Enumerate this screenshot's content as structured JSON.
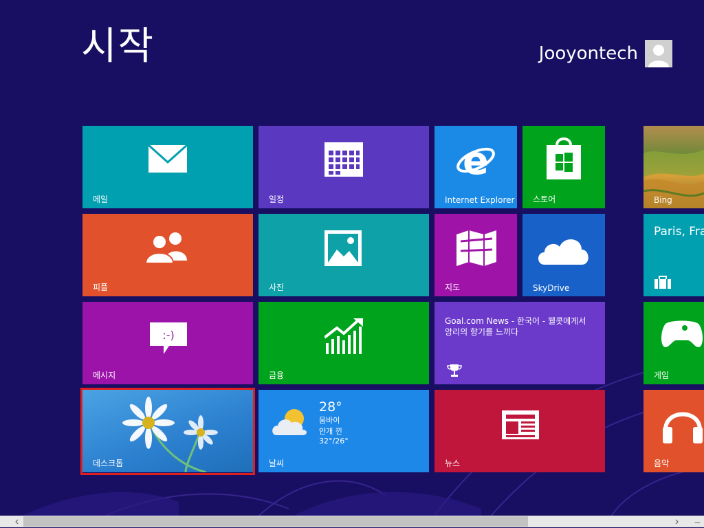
{
  "header": {
    "title": "시작",
    "user_name": "Jooyontech"
  },
  "colors": {
    "background": "#180E62",
    "selection": "#E02020"
  },
  "tiles": {
    "mail": {
      "label": "메일",
      "icon": "mail-icon",
      "color": "#00A0B0"
    },
    "calendar": {
      "label": "일정",
      "icon": "calendar-icon",
      "color": "#5A38C0"
    },
    "ie": {
      "label": "Internet Explorer",
      "icon": "internet-explorer-icon",
      "color": "#1B8AE6"
    },
    "store": {
      "label": "스토어",
      "icon": "store-icon",
      "color": "#00A31C"
    },
    "bing": {
      "label": "Bing",
      "icon": "bing-photo"
    },
    "people": {
      "label": "피플",
      "icon": "people-icon",
      "color": "#E1512B"
    },
    "photos": {
      "label": "사진",
      "icon": "photos-icon",
      "color": "#0EA1A8"
    },
    "maps": {
      "label": "지도",
      "icon": "maps-icon",
      "color": "#9F13A8"
    },
    "skydrive": {
      "label": "SkyDrive",
      "icon": "cloud-icon",
      "color": "#1761C9"
    },
    "travel": {
      "label": "Paris, Fra",
      "icon": "suitcase-icon",
      "color": "#00A0B0"
    },
    "messaging": {
      "label": "메시지",
      "icon": "message-icon",
      "color": "#9B13A9"
    },
    "finance": {
      "label": "금융",
      "icon": "chart-icon",
      "color": "#00A31C"
    },
    "sports": {
      "text": "Goal.com News - 한국어 - 웰콧에게서 앙리의 향기를 느끼다",
      "icon": "trophy-icon",
      "color": "#6B3ACB"
    },
    "games": {
      "label": "게임",
      "icon": "controller-icon",
      "color": "#00A31C"
    },
    "desktop": {
      "label": "데스크톱",
      "icon": "flower-wallpaper"
    },
    "weather": {
      "label": "날씨",
      "temp": "28°",
      "city": "뭄바이",
      "condition": "안개 낀",
      "range": "32°/26°",
      "icon": "partly-cloudy-icon",
      "color": "#1E88E8"
    },
    "news": {
      "label": "뉴스",
      "icon": "newspaper-icon",
      "color": "#C1163B"
    },
    "music": {
      "label": "음악",
      "icon": "headphones-icon",
      "color": "#E1512B"
    }
  },
  "scrollbar": {
    "left_arrow": "‹",
    "right_arrow": "›",
    "minus": "–"
  }
}
